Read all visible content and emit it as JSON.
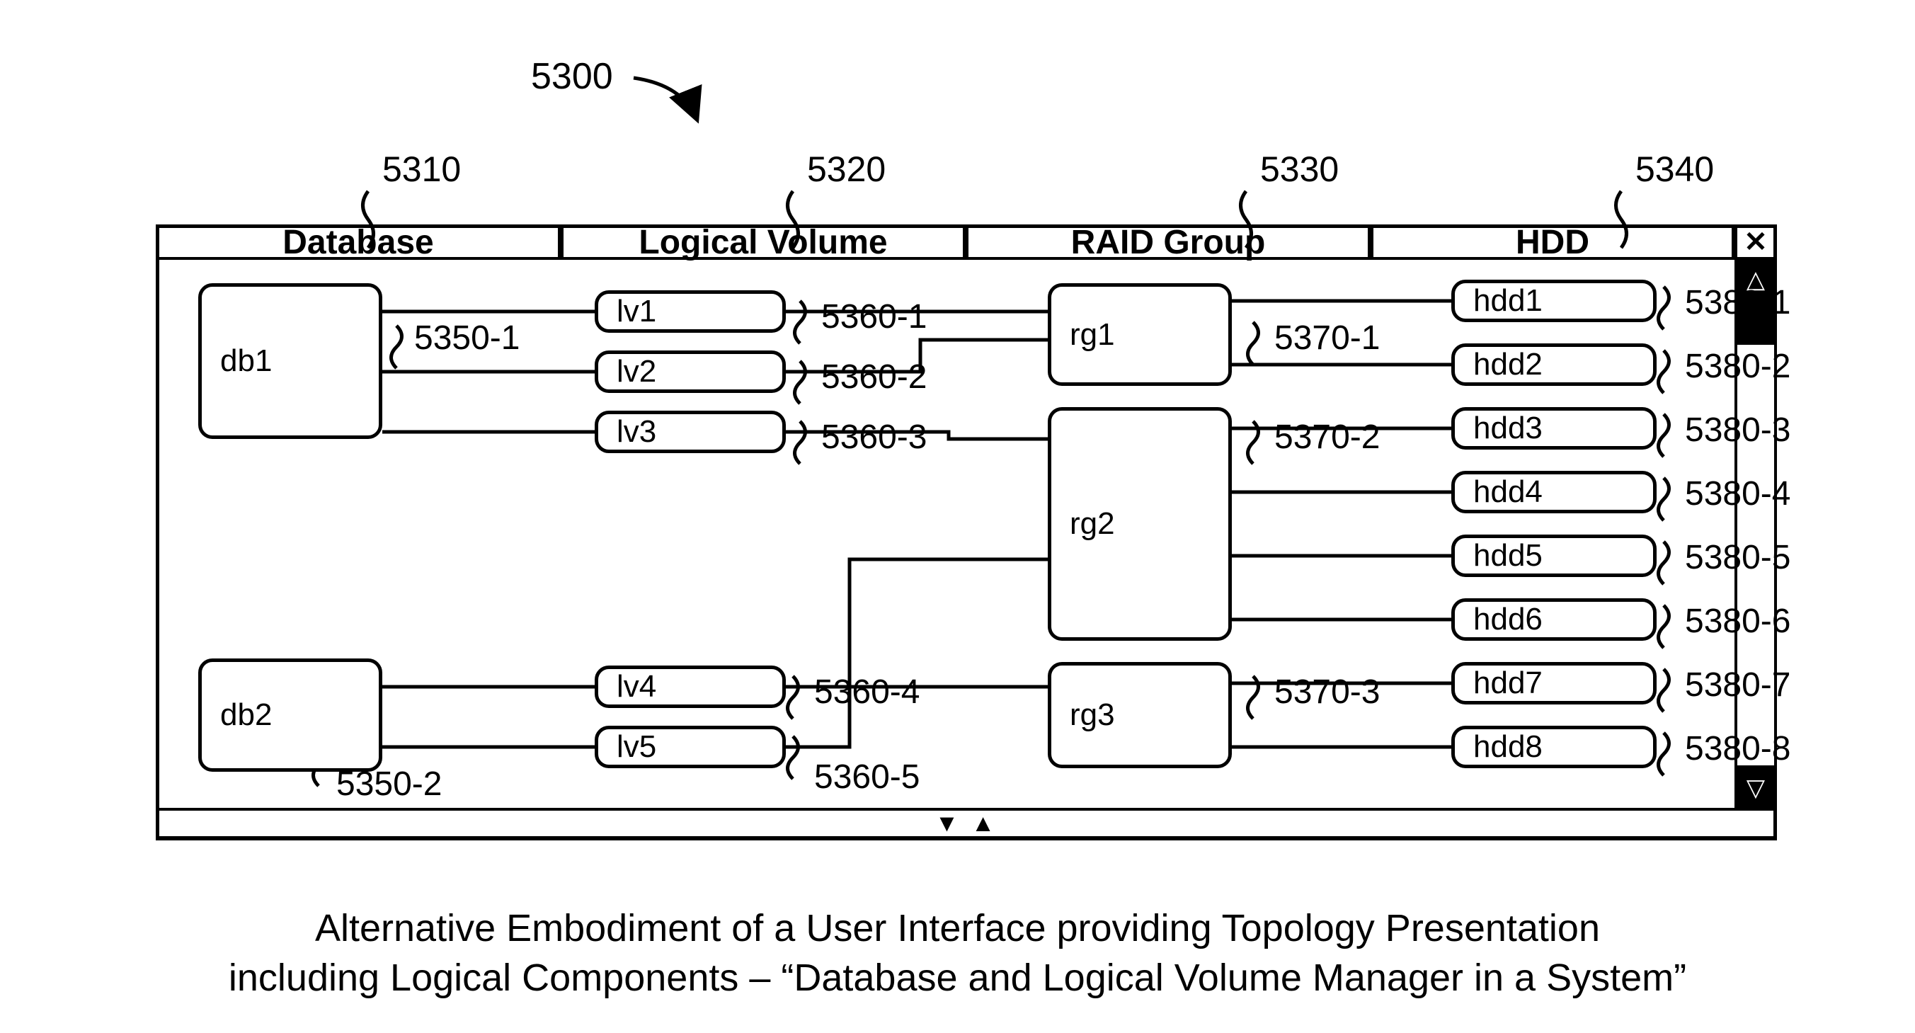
{
  "refs": {
    "main": "5300",
    "cols": {
      "database": "5310",
      "lv": "5320",
      "rg": "5330",
      "hdd": "5340"
    },
    "db": {
      "db1": "5350-1",
      "db2": "5350-2"
    },
    "lv": {
      "lv1": "5360-1",
      "lv2": "5360-2",
      "lv3": "5360-3",
      "lv4": "5360-4",
      "lv5": "5360-5"
    },
    "rg": {
      "rg1": "5370-1",
      "rg2": "5370-2",
      "rg3": "5370-3"
    },
    "hdd": {
      "hdd1": "5380-1",
      "hdd2": "5380-2",
      "hdd3": "5380-3",
      "hdd4": "5380-4",
      "hdd5": "5380-5",
      "hdd6": "5380-6",
      "hdd7": "5380-7",
      "hdd8": "5380-8"
    }
  },
  "headers": {
    "database": "Database",
    "lv": "Logical Volume",
    "rg": "RAID Group",
    "hdd": "HDD"
  },
  "nodes": {
    "db1": "db1",
    "db2": "db2",
    "lv1": "lv1",
    "lv2": "lv2",
    "lv3": "lv3",
    "lv4": "lv4",
    "lv5": "lv5",
    "rg1": "rg1",
    "rg2": "rg2",
    "rg3": "rg3",
    "hdd1": "hdd1",
    "hdd2": "hdd2",
    "hdd3": "hdd3",
    "hdd4": "hdd4",
    "hdd5": "hdd5",
    "hdd6": "hdd6",
    "hdd7": "hdd7",
    "hdd8": "hdd8"
  },
  "glyphs": {
    "close": "✕",
    "up": "△",
    "down": "▽",
    "pager": "▼    ▲"
  },
  "caption": {
    "line1": "Alternative Embodiment of a User Interface providing Topology Presentation",
    "line2": "including Logical Components – “Database and Logical Volume Manager in a System”"
  }
}
